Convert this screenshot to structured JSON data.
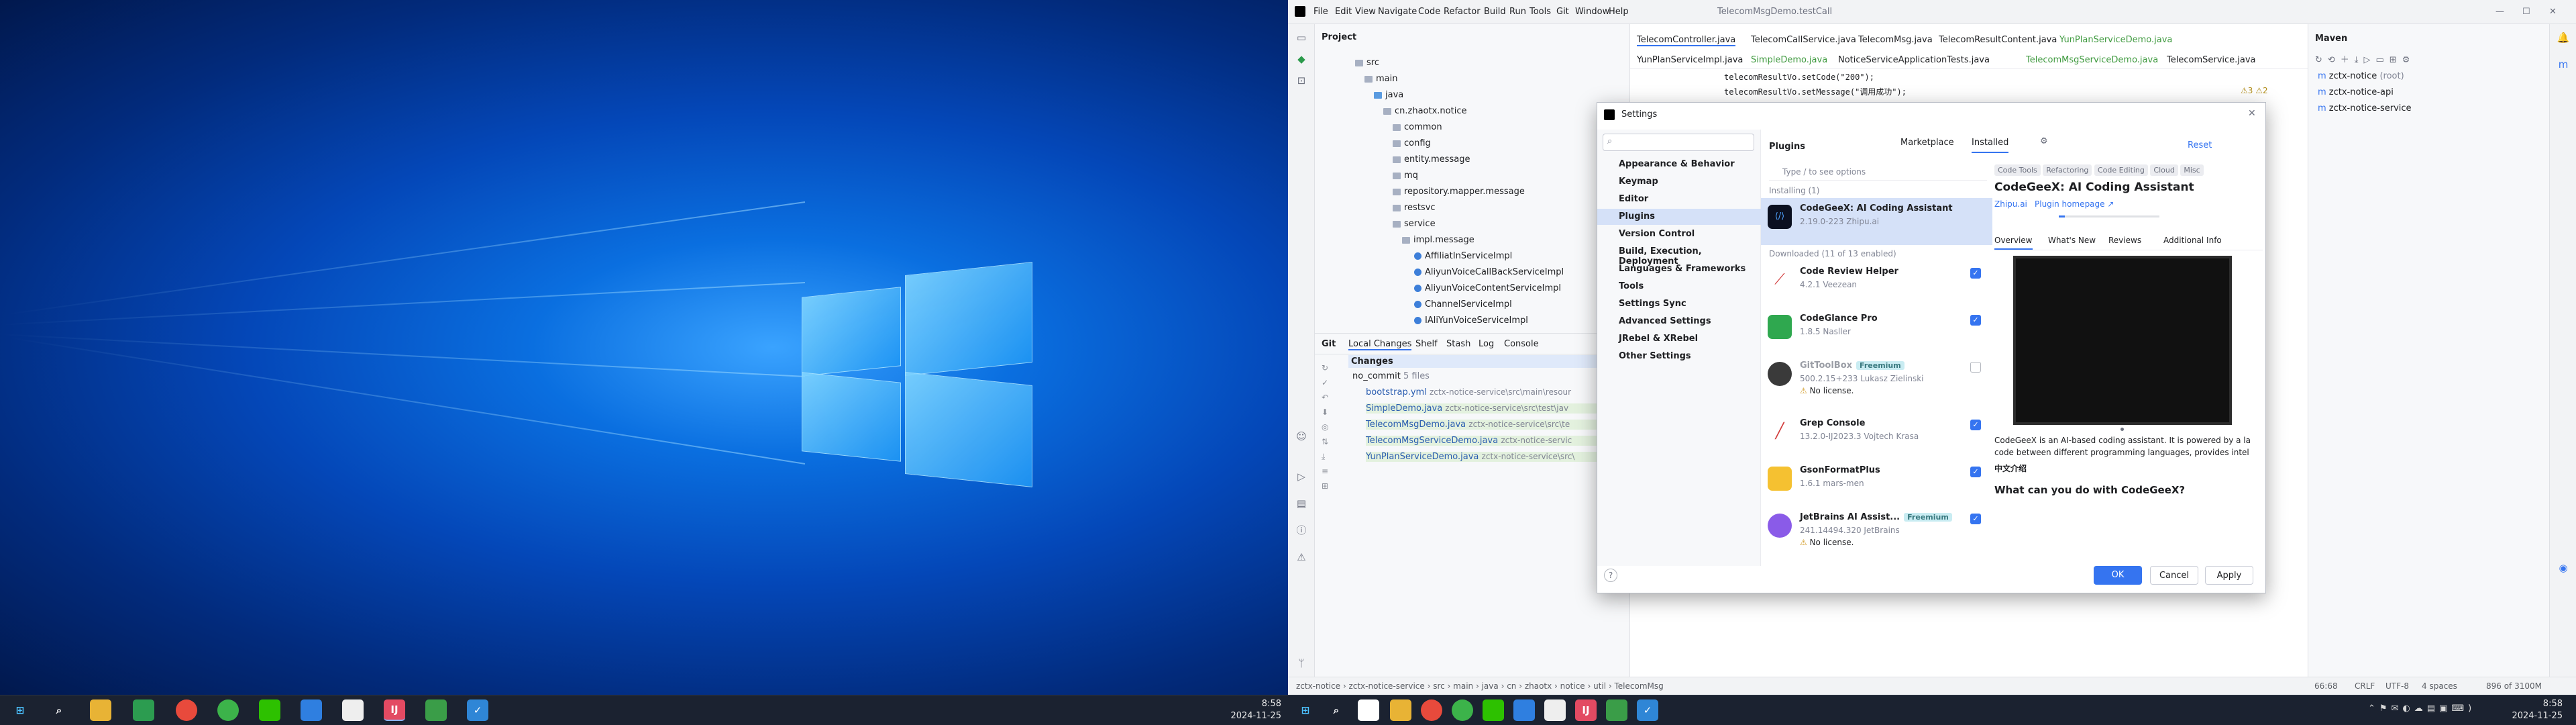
{
  "window_title": "TelecomMsgDemo.testCall",
  "menu": [
    "File",
    "Edit",
    "View",
    "Navigate",
    "Code",
    "Refactor",
    "Build",
    "Run",
    "Tools",
    "Git",
    "Window",
    "Help"
  ],
  "project": {
    "title": "Project",
    "tree": [
      "src",
      "main",
      "java",
      "cn.zhaotx.notice",
      "common",
      "config",
      "entity.message",
      "mq",
      "repository.mapper.message",
      "restsvc",
      "service",
      "impl.message",
      "AffiliatInServiceImpl",
      "AliyunVoiceCallBackServiceImpl",
      "AliyunVoiceContentServiceImpl",
      "ChannelServiceImpl",
      "IAliYunVoiceServiceImpl"
    ]
  },
  "git": {
    "tabs": [
      "Git",
      "Local Changes",
      "Shelf",
      "Stash",
      "Log",
      "Console"
    ],
    "changes_label": "Changes",
    "commit_label": "no_commit",
    "commit_count": "5 files",
    "files": [
      {
        "name": "bootstrap.yml",
        "path": "zctx-notice-service\\src\\main\\resour"
      },
      {
        "name": "SimpleDemo.java",
        "path": "zctx-notice-service\\src\\test\\jav"
      },
      {
        "name": "TelecomMsgDemo.java",
        "path": "zctx-notice-service\\src\\te"
      },
      {
        "name": "TelecomMsgServiceDemo.java",
        "path": "zctx-notice-servic"
      },
      {
        "name": "YunPlanServiceDemo.java",
        "path": "zctx-notice-service\\src\\"
      }
    ]
  },
  "editor": {
    "tabs_row1": [
      "TelecomController.java",
      "TelecomCallService.java",
      "TelecomMsg.java",
      "TelecomResultContent.java",
      "YunPlanServiceDemo.java"
    ],
    "tabs_row2": [
      "YunPlanServiceImpl.java",
      "SimpleDemo.java",
      "NoticeServiceApplicationTests.java",
      "TelecomMsgServiceDemo.java",
      "TelecomService.java"
    ],
    "code_line1": "telecomResultVo.setCode(\"200\");",
    "code_line2": "telecomResultVo.setMessage(\"调用成功\");",
    "warnings": "⚠3  ⚠2"
  },
  "maven": {
    "title": "Maven",
    "items": [
      {
        "name": "zctx-notice",
        "suffix": "(root)"
      },
      {
        "name": "zctx-notice-api",
        "suffix": ""
      },
      {
        "name": "zctx-notice-service",
        "suffix": ""
      }
    ]
  },
  "statusbar": {
    "breadcrumb": [
      "zctx-notice",
      "zctx-notice-service",
      "src",
      "main",
      "java",
      "cn",
      "zhaotx",
      "notice",
      "util",
      "TelecomMsg"
    ],
    "position": "66:68",
    "line_sep": "CRLF",
    "encoding": "UTF-8",
    "indent": "4 spaces",
    "memory": "896 of 3100M"
  },
  "settings": {
    "title": "Settings",
    "nav": [
      "Appearance & Behavior",
      "Keymap",
      "Editor",
      "Plugins",
      "Version Control",
      "Build, Execution, Deployment",
      "Languages & Frameworks",
      "Tools",
      "Settings Sync",
      "Advanced Settings",
      "JRebel & XRebel",
      "Other Settings"
    ],
    "header": "Plugins",
    "tabs": [
      "Marketplace",
      "Installed"
    ],
    "reset": "Reset",
    "search_placeholder": "Type / to see options",
    "installing_label": "Installing (1)",
    "downloaded_label": "Downloaded (11 of 13 enabled)",
    "plugins": [
      {
        "name": "CodeGeeX: AI Coding Assistant",
        "sub": "2.19.0-223  Zhipu.ai",
        "checked": null,
        "badge": "",
        "warn": ""
      },
      {
        "name": "Code Review Helper",
        "sub": "4.2.1  Veezean",
        "checked": true,
        "badge": "",
        "warn": ""
      },
      {
        "name": "CodeGlance Pro",
        "sub": "1.8.5  Nasller",
        "checked": true,
        "badge": "",
        "warn": ""
      },
      {
        "name": "GitToolBox",
        "sub": "500.2.15+233  Lukasz Zielinski",
        "checked": false,
        "badge": "Freemium",
        "warn": "No license."
      },
      {
        "name": "Grep Console",
        "sub": "13.2.0-IJ2023.3  Vojtech Krasa",
        "checked": true,
        "badge": "",
        "warn": ""
      },
      {
        "name": "GsonFormatPlus",
        "sub": "1.6.1  mars-men",
        "checked": true,
        "badge": "",
        "warn": ""
      },
      {
        "name": "JetBrains AI Assist...",
        "sub": "241.14494.320  JetBrains",
        "checked": true,
        "badge": "Freemium",
        "warn": "No license."
      }
    ],
    "detail": {
      "tags": [
        "Code Tools",
        "Refactoring",
        "Code Editing",
        "Cloud",
        "Misc"
      ],
      "title": "CodeGeeX: AI Coding Assistant",
      "vendor": "Zhipu.ai",
      "homepage": "Plugin homepage ↗",
      "tabs": [
        "Overview",
        "What's New",
        "Reviews",
        "Additional Info"
      ],
      "desc1": "CodeGeeX is an AI-based coding assistant. It is powered by a la",
      "desc2": "code between different programming languages, provides intel",
      "chinese": "中文介绍",
      "heading": "What can you do with CodeGeeX?"
    },
    "buttons": {
      "ok": "OK",
      "cancel": "Cancel",
      "apply": "Apply"
    },
    "help": "?"
  },
  "taskbar_left": {
    "time": "8:58",
    "date": "2024-11-25"
  },
  "taskbar_right": {
    "time": "8:58",
    "date": "2024-11-25"
  },
  "colors": {
    "accent": "#3574f0",
    "desktop": "#0a5bd6",
    "taskbar": "#1b2230"
  }
}
